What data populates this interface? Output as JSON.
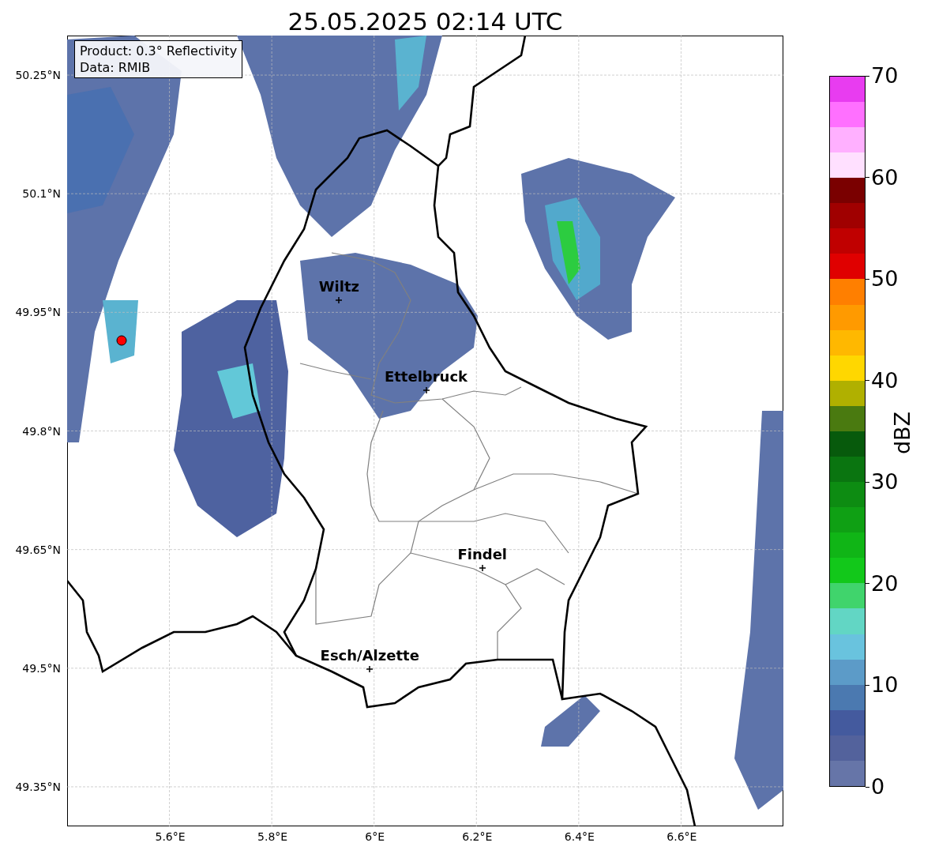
{
  "title": "25.05.2025 02:14 UTC",
  "info": [
    "Product: 0.3° Reflectivity",
    "Data: RMIB"
  ],
  "map": {
    "xticks": [
      "5.6°E",
      "5.8°E",
      "6°E",
      "6.2°E",
      "6.4°E",
      "6.6°E"
    ],
    "yticks": [
      "50.25°N",
      "50.1°N",
      "49.95°N",
      "49.8°N",
      "49.65°N",
      "49.5°N",
      "49.35°N"
    ],
    "cities": [
      {
        "name": "Wiltz"
      },
      {
        "name": "Ettelbruck"
      },
      {
        "name": "Findel"
      },
      {
        "name": "Esch/Alzette"
      }
    ]
  },
  "colorbar": {
    "label": "dBZ",
    "ticks": [
      "70",
      "60",
      "50",
      "40",
      "30",
      "20",
      "10",
      "0"
    ]
  }
}
